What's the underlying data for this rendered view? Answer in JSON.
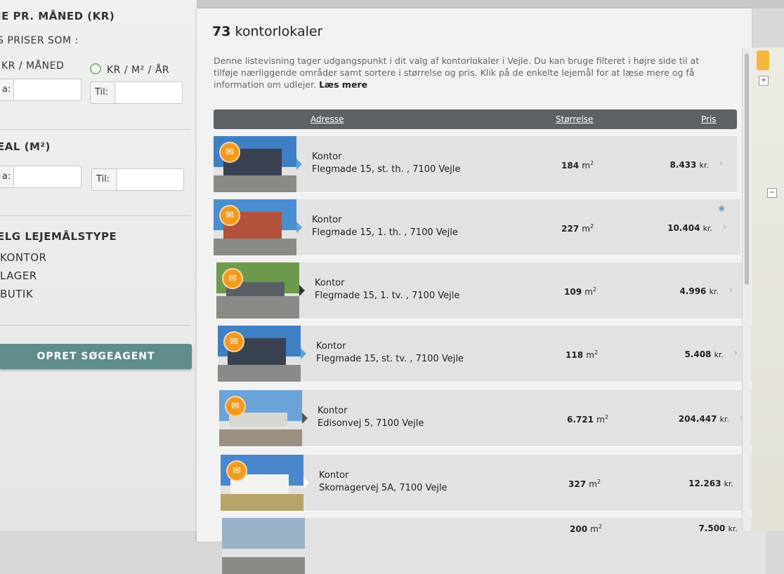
{
  "filters": {
    "price_heading": "JE PR. MÅNED (KR)",
    "show_prices_as": "S PRISER SOM :",
    "opt_monthly": "KR / MÅNED",
    "opt_m2_year": "KR / M² / ÅR",
    "from_label": "a:",
    "to_label": "Til:",
    "area_heading": "EAL (M²)",
    "area_from_label": "a:",
    "area_to_label": "Til:",
    "type_heading": "ELG LEJEMÅLSTYPE",
    "types": [
      "KONTOR",
      "LAGER",
      "BUTIK"
    ],
    "agent_button": "OPRET SØGEAGENT"
  },
  "list": {
    "count": "73",
    "count_label": "kontorlokaler",
    "intro": "Denne listevisning tager udgangspunkt i dit valg af kontorlokaler i Vejle. Du kan bruge filteret i højre side til at tilføje nærliggende områder samt sortere i størrelse og pris. Klik på de enkelte lejemål for at læse mere og få information om udlejer.",
    "read_more": "Læs mere",
    "col_address": "Adresse",
    "col_size": "Størrelse",
    "col_price": "Pris",
    "rows": [
      {
        "type": "Kontor",
        "address": "Flegmade 15, st. th. , 7100 Vejle",
        "size": "184",
        "unit": "m",
        "price": "8.433",
        "currency": "kr."
      },
      {
        "type": "Kontor",
        "address": "Flegmade 15, 1. th. , 7100 Vejle",
        "size": "227",
        "unit": "m",
        "price": "10.404",
        "currency": "kr."
      },
      {
        "type": "Kontor",
        "address": "Flegmade 15, 1. tv. , 7100 Vejle",
        "size": "109",
        "unit": "m",
        "price": "4.996",
        "currency": "kr."
      },
      {
        "type": "Kontor",
        "address": "Flegmade 15, st. tv. , 7100 Vejle",
        "size": "118",
        "unit": "m",
        "price": "5.408",
        "currency": "kr."
      },
      {
        "type": "Kontor",
        "address": "Edisonvej 5, 7100 Vejle",
        "size": "6.721",
        "unit": "m",
        "price": "204.447",
        "currency": "kr."
      },
      {
        "type": "Kontor",
        "address": "Skomagervej 5A, 7100 Vejle",
        "size": "327",
        "unit": "m",
        "price": "12.263",
        "currency": "kr."
      },
      {
        "type": "",
        "address": "",
        "size": "200",
        "unit": "m",
        "price": "7.500",
        "currency": "kr."
      }
    ]
  },
  "map": {
    "zoom_in": "+",
    "zoom_out": "−"
  },
  "colors": {
    "accent_green": "#7ec26a",
    "button_teal": "#5f8c8c",
    "mail_orange": "#f29a1e",
    "header_dark": "#5c6266"
  }
}
